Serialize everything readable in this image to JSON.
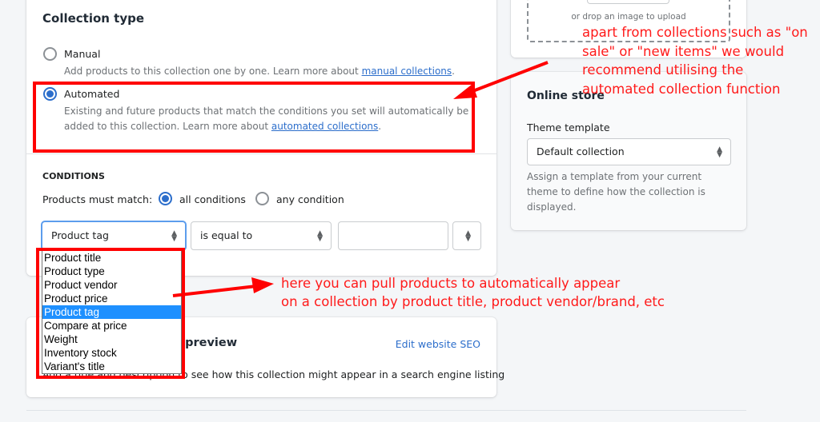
{
  "collection_type": {
    "title": "Collection type",
    "manual": {
      "label": "Manual",
      "help": "Add products to this collection one by one. Learn more about ",
      "link": "manual collections",
      "selected": false
    },
    "automated": {
      "label": "Automated",
      "help": "Existing and future products that match the conditions you set will automatically be added to this collection. Learn more about ",
      "link": "automated collections",
      "selected": true
    }
  },
  "conditions": {
    "title": "CONDITIONS",
    "match_label": "Products must match:",
    "all": "all conditions",
    "any": "any condition",
    "selected": "all",
    "field": "Product tag",
    "operator": "is equal to",
    "value": "",
    "field_options": [
      "Product title",
      "Product type",
      "Product vendor",
      "Product price",
      "Product tag",
      "Compare at price",
      "Weight",
      "Inventory stock",
      "Variant's title"
    ],
    "highlighted": "Product tag"
  },
  "seo": {
    "title": "Search engine listing preview",
    "edit_link": "Edit website SEO",
    "help": "Add a title and description to see how this collection might appear in a search engine listing"
  },
  "upload": {
    "hint": "or drop an image to upload"
  },
  "online_store": {
    "title": "Online store",
    "theme_label": "Theme template",
    "theme_value": "Default collection",
    "help": "Assign a template from your current theme to define how the collection is displayed."
  },
  "annotations": {
    "top": "apart from collections such as \"on sale\" or \"new items\" we would recommend utilising the automated collection function",
    "bottom_line1": "here you can pull products to automatically appear",
    "bottom_line2": "on a collection by product title, product vendor/brand, etc",
    "color": "#ff0000"
  }
}
